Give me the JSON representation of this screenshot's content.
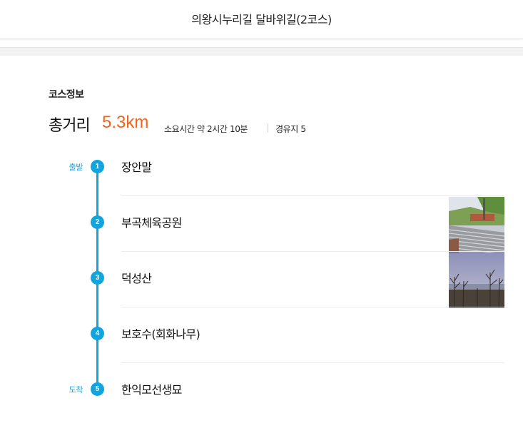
{
  "header": {
    "title": "의왕시누리길 달바위길(2코스)"
  },
  "course": {
    "section_label": "코스정보",
    "total_label": "총거리",
    "total_value": "5.3km",
    "time_info": "소요시간 약 2시간 10분",
    "stops_info": "경유지 5"
  },
  "stops": [
    {
      "number": "1",
      "tag": "출발",
      "name": "장안말"
    },
    {
      "number": "2",
      "tag": "",
      "name": "부곡체육공원",
      "thumbnail": "stadium-stairs-photo"
    },
    {
      "number": "3",
      "tag": "",
      "name": "덕성산",
      "thumbnail": "bare-trees-sky-photo"
    },
    {
      "number": "4",
      "tag": "",
      "name": "보호수(회화나무)"
    },
    {
      "number": "5",
      "tag": "도착",
      "name": "한익모선생묘"
    }
  ],
  "colors": {
    "accent": "#12a4dd",
    "distance": "#f4621b"
  }
}
